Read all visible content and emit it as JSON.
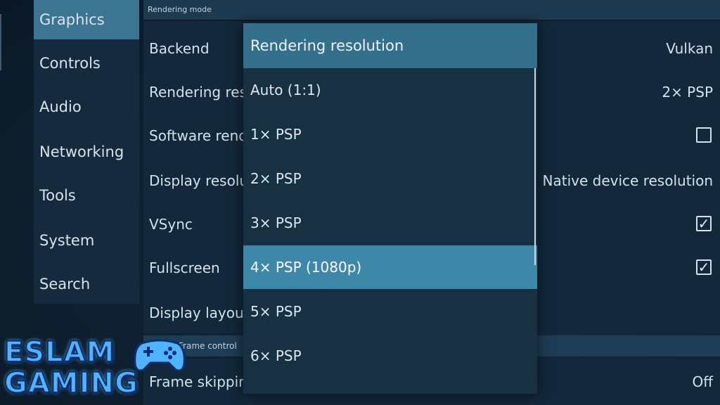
{
  "sidebar": {
    "items": [
      {
        "label": "Graphics",
        "active": true
      },
      {
        "label": "Controls"
      },
      {
        "label": "Audio"
      },
      {
        "label": "Networking"
      },
      {
        "label": "Tools"
      },
      {
        "label": "System"
      },
      {
        "label": "Search"
      }
    ]
  },
  "section": {
    "header": "Rendering mode",
    "subheader": "Frame control"
  },
  "settings": [
    {
      "label": "Backend",
      "value": "Vulkan"
    },
    {
      "label": "Rendering reso",
      "value": "2× PSP"
    },
    {
      "label": "Software render",
      "checked": false
    },
    {
      "label": "Display resolutio",
      "value": "Native device resolution"
    },
    {
      "label": "VSync",
      "checked": true
    },
    {
      "label": "Fullscreen",
      "checked": true
    },
    {
      "label": "Display layout &",
      "value": ""
    }
  ],
  "bottom_setting": {
    "label": "Frame skipping",
    "value": "Off"
  },
  "popup": {
    "title": "Rendering resolution",
    "options": [
      "Auto (1:1)",
      "1× PSP",
      "2× PSP",
      "3× PSP",
      "4× PSP (1080p)",
      "5× PSP",
      "6× PSP"
    ],
    "selected_index": 4
  },
  "logo": {
    "line1": "ESLAM",
    "line2": "GAMING"
  },
  "colors": {
    "accent": "#3d87a8",
    "sidebar_active": "#3b7591",
    "logo": "#4fb3ff"
  }
}
